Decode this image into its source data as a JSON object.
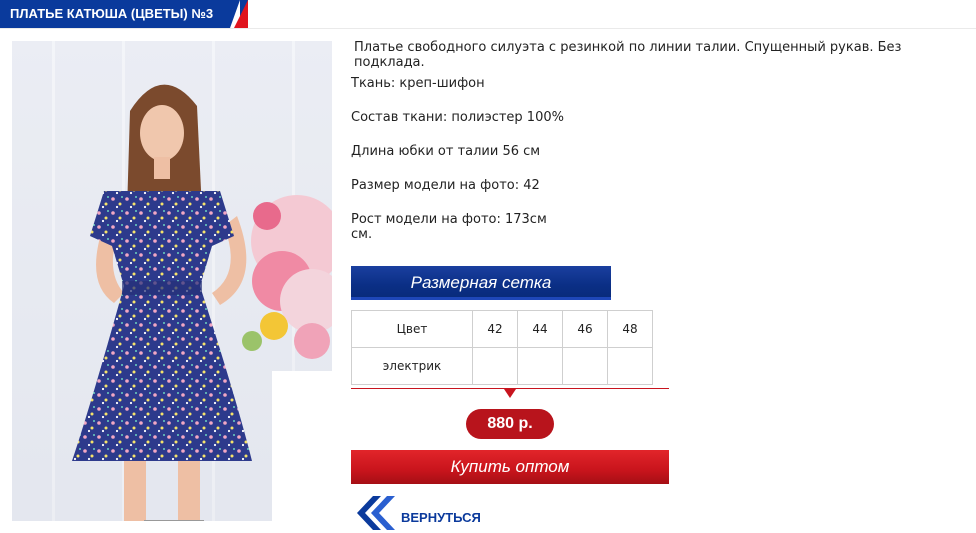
{
  "product": {
    "title": "ПЛАТЬЕ КАТЮША (ЦВЕТЫ) №3",
    "description": "Платье свободного силуэта с резинкой по линии талии. Спущенный рукав. Без подклада.",
    "fabric": "Ткань: креп-шифон",
    "composition": "Состав ткани: полиэстер 100%",
    "skirt_length": "Длина юбки от талии 56 см",
    "model_size": "Размер модели на фото: 42",
    "model_height": "Рост модели на фото: 173см",
    "model_height_unit": "см.",
    "photo_alt": "model-in-floral-dress"
  },
  "size_chart": {
    "button_label": "Размерная сетка",
    "header": [
      "Цвет",
      "42",
      "44",
      "46",
      "48"
    ],
    "rows": [
      [
        "электрик",
        "",
        "",
        "",
        ""
      ]
    ]
  },
  "price": "880 р.",
  "buy_label": "Купить оптом",
  "back_label": "ВЕРНУТЬСЯ",
  "colors": {
    "brand_blue": "#0a3a9c",
    "brand_red": "#c8141c",
    "dress_blue": "#2d3a8c"
  }
}
